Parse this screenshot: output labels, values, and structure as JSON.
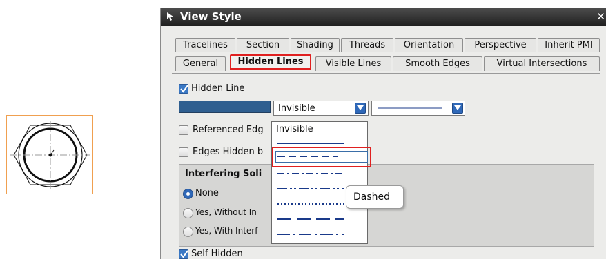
{
  "dialog": {
    "title": "View Style",
    "close_label": "✕"
  },
  "tabs_row1": [
    "Tracelines",
    "Section",
    "Shading",
    "Threads",
    "Orientation",
    "Perspective",
    "Inherit PMI"
  ],
  "tabs_row2": [
    "General",
    "Hidden Lines",
    "Visible Lines",
    "Smooth Edges",
    "Virtual Intersections"
  ],
  "active_tab": "Hidden Lines",
  "hidden_line": {
    "label": "Hidden Line",
    "checked": true,
    "color": "#2f5f90",
    "style_value": "Invisible"
  },
  "referenced_edges_label": "Referenced Edg",
  "edges_hidden_label": "Edges Hidden b",
  "interfering": {
    "title": "Interfering Soli",
    "options": [
      "None",
      "Yes, Without In",
      "Yes, With Interf"
    ],
    "selected": "None"
  },
  "self_hidden": {
    "label": "Self Hidden",
    "checked": true
  },
  "line_style_dropdown": {
    "items": [
      "Invisible",
      "solid",
      "dashed",
      "dash-dot",
      "dash-dot-dot",
      "dotted",
      "long-dash",
      "long-dash-dot"
    ],
    "highlighted": "dashed"
  },
  "tooltip": "Dashed",
  "colors": {
    "highlight_border": "#e02020",
    "accent": "#2f68b8",
    "line_color": "#1a3a8a"
  }
}
